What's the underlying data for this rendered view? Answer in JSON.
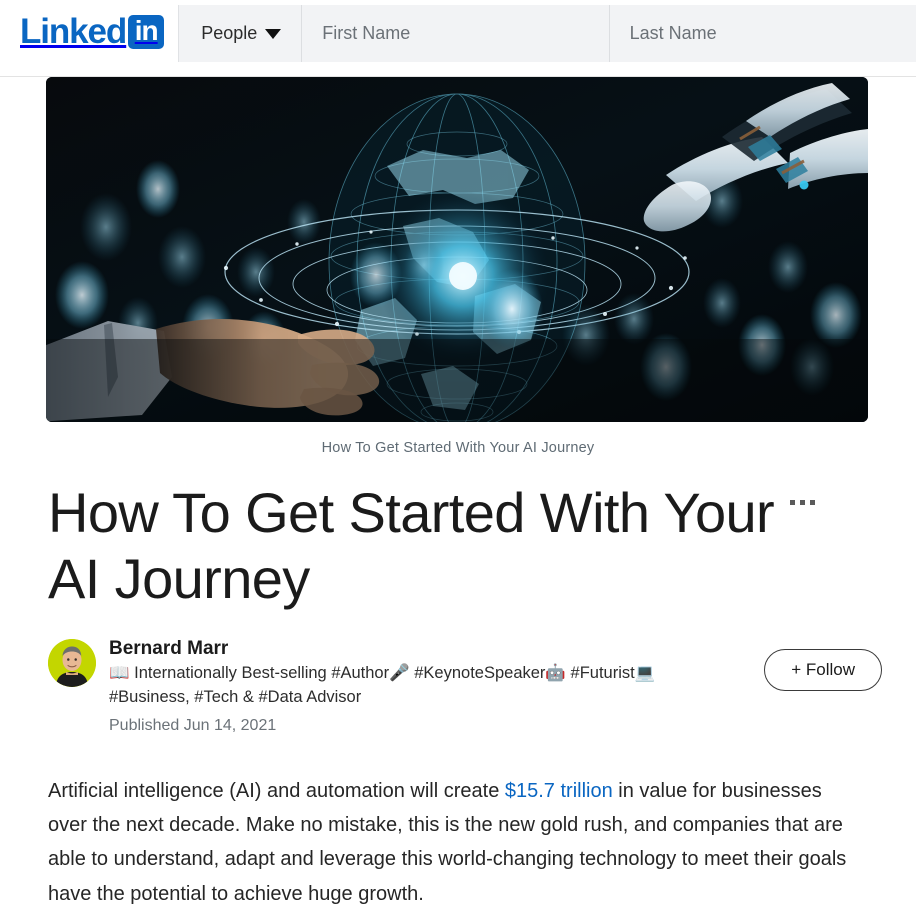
{
  "header": {
    "logo": {
      "word": "Linked",
      "box": "in",
      "color": "#0a66c2"
    },
    "search": {
      "facet_label": "People",
      "facet_icon": "chevron-down-icon",
      "first_name_placeholder": "First Name",
      "first_name_value": "",
      "last_name_placeholder": "Last Name",
      "last_name_value": ""
    }
  },
  "article": {
    "hero_caption": "How To Get Started With Your AI Journey",
    "title": "How To Get Started With Your AI Journey",
    "menu_icon": "kebab-menu-icon",
    "author": {
      "name": "Bernard Marr",
      "headline": "📖 Internationally Best-selling #Author🎤 #KeynoteSpeaker🤖 #Futurist💻 #Business, #Tech & #Data Advisor",
      "published": "Published Jun 14, 2021",
      "follow_label": "+ Follow",
      "avatar_bg": "#c3d600"
    },
    "body": {
      "paragraph_1_before": "Artificial intelligence (AI) and automation will create ",
      "paragraph_1_link": "$15.7 trillion",
      "paragraph_1_after": " in value for businesses over the next decade. Make no mistake, this is the new gold rush, and companies that are able to understand, adapt and leverage this world-changing technology to meet their goals have the potential to achieve huge growth.",
      "link_color": "#0a66c2"
    }
  }
}
